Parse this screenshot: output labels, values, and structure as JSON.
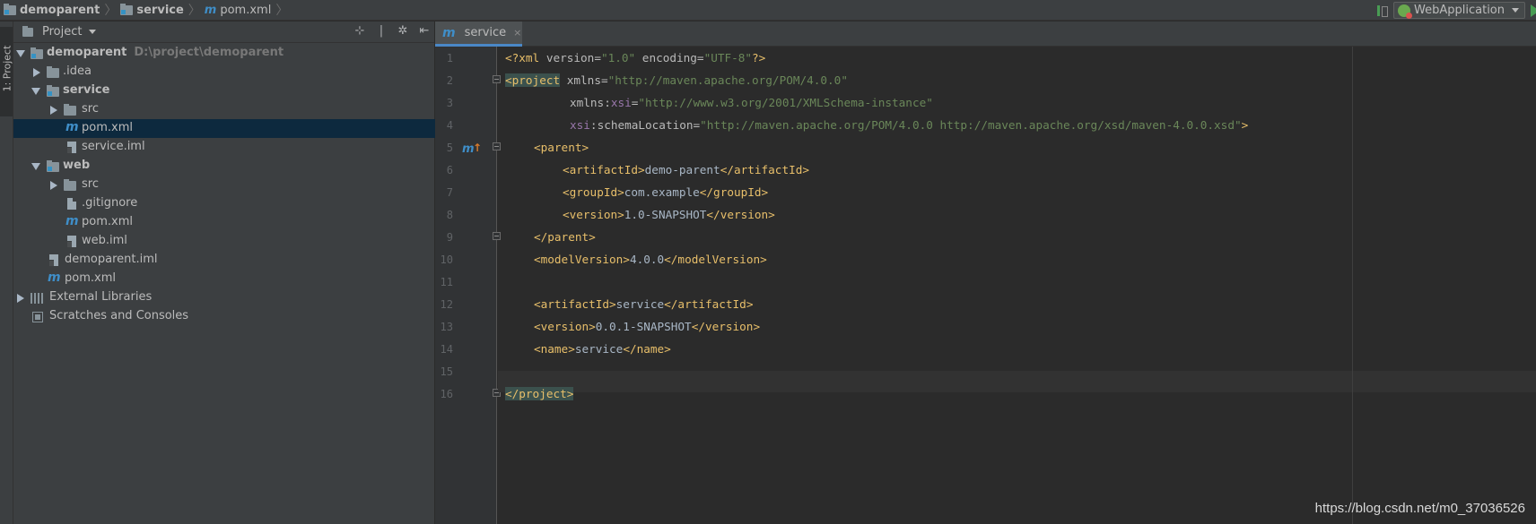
{
  "breadcrumb": {
    "items": [
      "demoparent",
      "service",
      "pom.xml"
    ]
  },
  "run_config": {
    "label": "WebApplication"
  },
  "tool_strip": {
    "label": "1: Project"
  },
  "project_panel": {
    "title": "Project",
    "tree": [
      {
        "label": "demoparent",
        "hint": "D:\\project\\demoparent"
      },
      {
        "label": ".idea"
      },
      {
        "label": "service"
      },
      {
        "label": "src"
      },
      {
        "label": "pom.xml"
      },
      {
        "label": "service.iml"
      },
      {
        "label": "web"
      },
      {
        "label": "src"
      },
      {
        "label": ".gitignore"
      },
      {
        "label": "pom.xml"
      },
      {
        "label": "web.iml"
      },
      {
        "label": "demoparent.iml"
      },
      {
        "label": "pom.xml"
      },
      {
        "label": "External Libraries"
      },
      {
        "label": "Scratches and Consoles"
      }
    ]
  },
  "editor": {
    "tab": {
      "label": "service",
      "close": "×"
    },
    "line_numbers": [
      "1",
      "2",
      "3",
      "4",
      "5",
      "6",
      "7",
      "8",
      "9",
      "10",
      "11",
      "12",
      "13",
      "14",
      "15",
      "16"
    ],
    "code": {
      "l1": {
        "open": "<?xml ",
        "a1": "version",
        "eq1": "=",
        "v1": "\"1.0\"",
        "a2": " encoding",
        "eq2": "=",
        "v2": "\"UTF-8\"",
        "close": "?>"
      },
      "l2": {
        "lt": "<",
        "tag": "project",
        "attr": " xmlns",
        "eq": "=",
        "val": "\"http://maven.apache.org/POM/4.0.0\""
      },
      "l3": {
        "attr": "xmlns",
        "colon": ":",
        "ns": "xsi",
        "eq": "=",
        "val": "\"http://www.w3.org/2001/XMLSchema-instance\""
      },
      "l4": {
        "ns": "xsi",
        "colon": ":",
        "attr": "schemaLocation",
        "eq": "=",
        "val": "\"http://maven.apache.org/POM/4.0.0 http://maven.apache.org/xsd/maven-4.0.0.xsd\"",
        "gt": ">"
      },
      "l5": {
        "tag": "<parent>"
      },
      "l6": {
        "open": "<artifactId>",
        "text": "demo-parent",
        "close": "</artifactId>"
      },
      "l7": {
        "open": "<groupId>",
        "text": "com.example",
        "close": "</groupId>"
      },
      "l8": {
        "open": "<version>",
        "text": "1.0-SNAPSHOT",
        "close": "</version>"
      },
      "l9": {
        "tag": "</parent>"
      },
      "l10": {
        "open": "<modelVersion>",
        "text": "4.0.0",
        "close": "</modelVersion>"
      },
      "l12": {
        "open": "<artifactId>",
        "text": "service",
        "close": "</artifactId>"
      },
      "l13": {
        "open": "<version>",
        "text": "0.0.1-SNAPSHOT",
        "close": "</version>"
      },
      "l14": {
        "open": "<name>",
        "text": "service",
        "close": "</name>"
      },
      "l16": {
        "tag": "</project>"
      }
    }
  },
  "watermark": "https://blog.csdn.net/m0_37036526",
  "colors": {
    "background": "#2b2b2b",
    "panel": "#3c3f41",
    "selection": "#0d293e",
    "tag": "#e8bf6a",
    "string": "#6a8759",
    "namespace": "#9876aa",
    "accent": "#4a88c7"
  }
}
